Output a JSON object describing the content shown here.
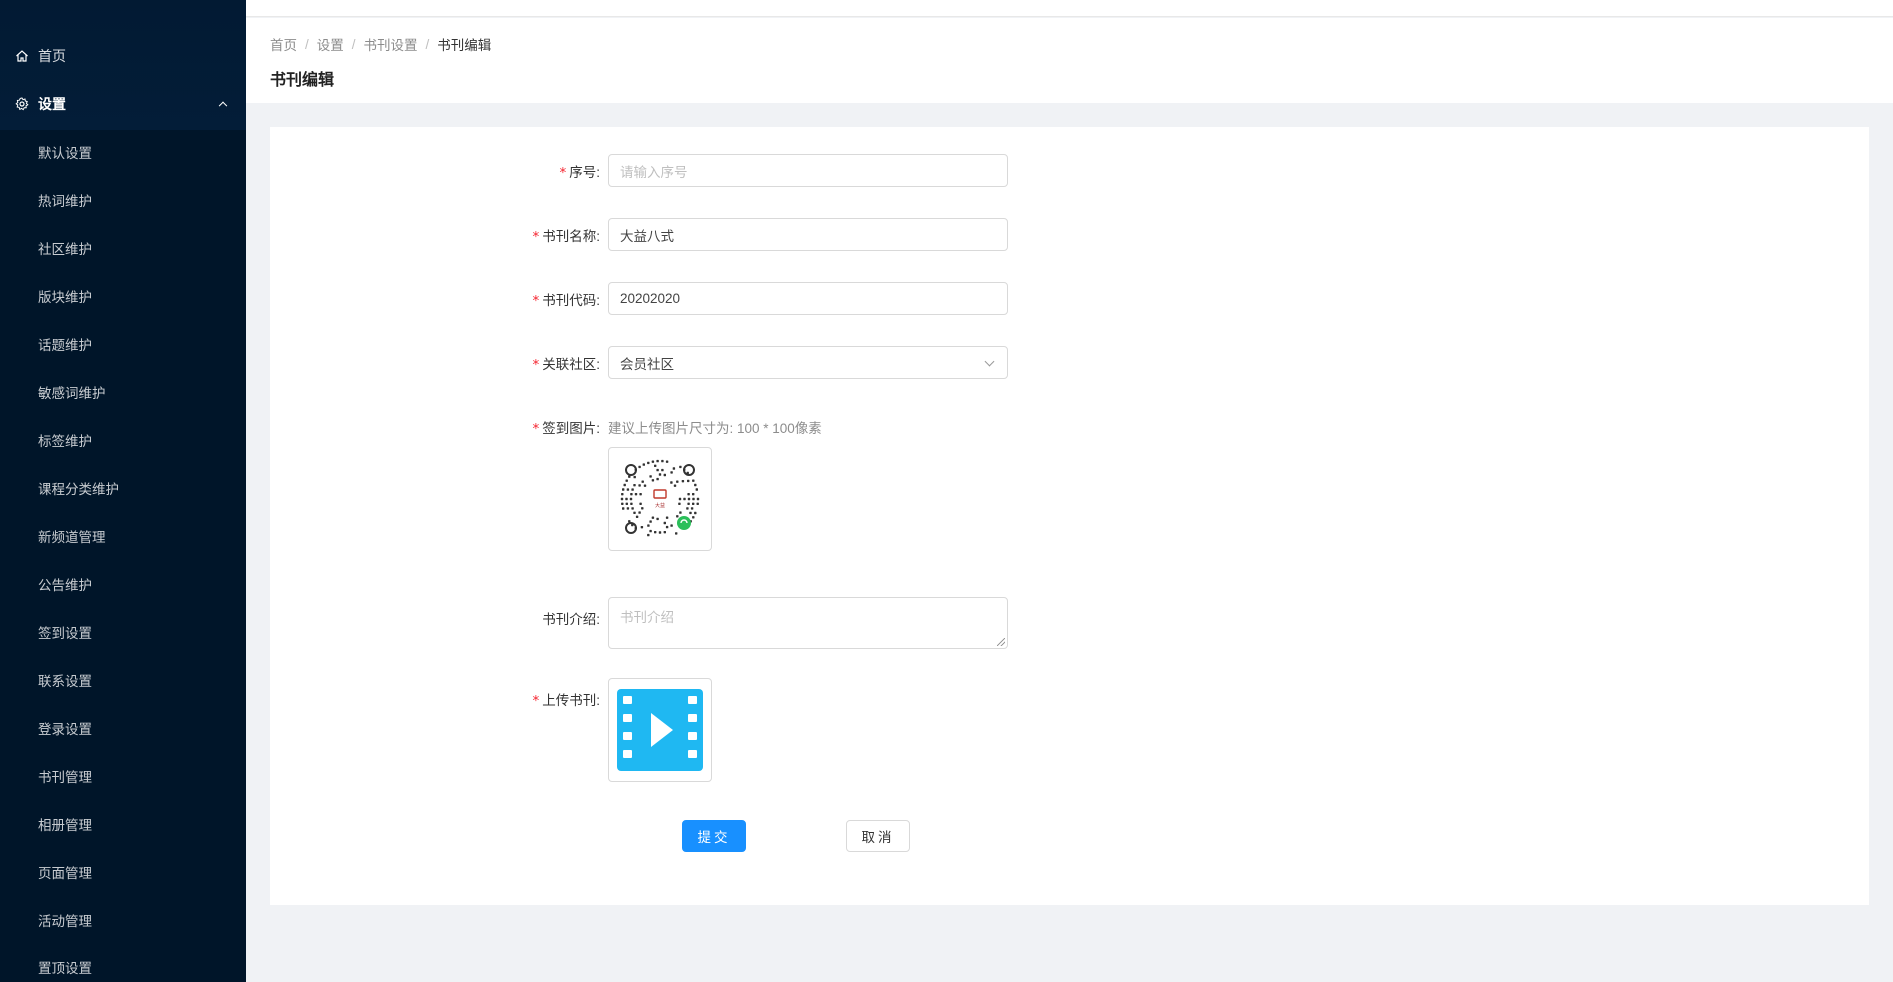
{
  "sidebar": {
    "home_label": "首页",
    "settings_label": "设置",
    "items": [
      {
        "label": "默认设置"
      },
      {
        "label": "热词维护"
      },
      {
        "label": "社区维护"
      },
      {
        "label": "版块维护"
      },
      {
        "label": "话题维护"
      },
      {
        "label": "敏感词维护"
      },
      {
        "label": "标签维护"
      },
      {
        "label": "课程分类维护"
      },
      {
        "label": "新频道管理"
      },
      {
        "label": "公告维护"
      },
      {
        "label": "签到设置"
      },
      {
        "label": "联系设置"
      },
      {
        "label": "登录设置"
      },
      {
        "label": "书刊管理"
      },
      {
        "label": "相册管理"
      },
      {
        "label": "页面管理"
      },
      {
        "label": "活动管理"
      },
      {
        "label": "置顶设置"
      }
    ]
  },
  "breadcrumb": [
    "首页",
    "设置",
    "书刊设置",
    "书刊编辑"
  ],
  "breadcrumb_sep": "/",
  "page_title": "书刊编辑",
  "form": {
    "seq": {
      "label": "序号:",
      "placeholder": "请输入序号"
    },
    "name": {
      "label": "书刊名称:",
      "value": "大益八式"
    },
    "code": {
      "label": "书刊代码:",
      "value": "20202020"
    },
    "community": {
      "label": "关联社区:",
      "value": "会员社区"
    },
    "checkin_image": {
      "label": "签到图片:",
      "hint": "建议上传图片尺寸为: 100 * 100像素"
    },
    "intro": {
      "label": "书刊介绍:",
      "placeholder": "书刊介绍"
    },
    "upload": {
      "label": "上传书刊:"
    },
    "required_mark": "*",
    "submit_label": "提交",
    "cancel_label": "取消"
  },
  "colors": {
    "sidebar_bg": "#001529",
    "primary": "#1890ff",
    "required": "#f5222d",
    "video_icon": "#1fb8f2"
  }
}
